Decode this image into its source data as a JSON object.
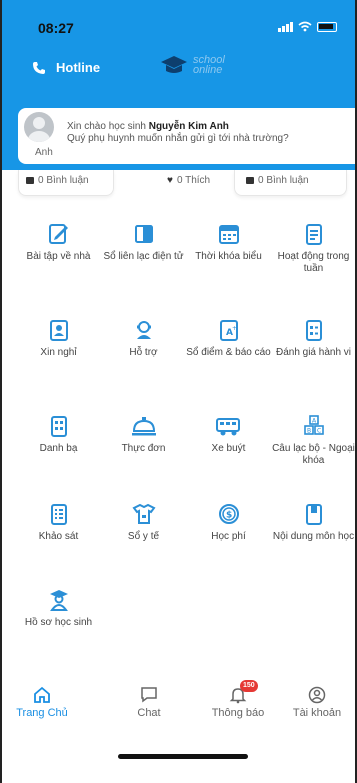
{
  "status_bar": {
    "time": "08:27"
  },
  "header": {
    "hotline_label": "Hotline",
    "logo_text_1": "school",
    "logo_text_2": "online"
  },
  "greeting": {
    "avatar_name": "Anh",
    "line1_prefix": "Xin chào học sinh ",
    "student_name": "Nguyễn Kim Anh",
    "line2": "Quý phụ huynh muốn nhắn gửi gì tới nhà trường?"
  },
  "stats": [
    {
      "icon": "comment-icon",
      "label": "0 Bình luận"
    },
    {
      "icon": "heart-icon",
      "label": "0 Thích"
    },
    {
      "icon": "comment-icon",
      "label": "0 Bình luận"
    }
  ],
  "menu": [
    {
      "id": "homework",
      "icon": "homework-icon",
      "label": "Bài tập về nhà"
    },
    {
      "id": "contact-book",
      "icon": "contact-book-icon",
      "label": "Sổ liên lạc điện tử"
    },
    {
      "id": "timetable",
      "icon": "calendar-icon",
      "label": "Thời khóa biểu"
    },
    {
      "id": "weekly-activities",
      "icon": "clipboard-icon",
      "label": "Hoạt động trong tuần"
    },
    {
      "id": "leave",
      "icon": "leave-icon",
      "label": "Xin nghỉ"
    },
    {
      "id": "support",
      "icon": "support-icon",
      "label": "Hỗ trợ"
    },
    {
      "id": "grades",
      "icon": "grade-book-icon",
      "label": "Sổ điểm & báo cáo"
    },
    {
      "id": "conduct",
      "icon": "evaluation-icon",
      "label": "Đánh giá hành vi"
    },
    {
      "id": "directory",
      "icon": "directory-icon",
      "label": "Danh bạ"
    },
    {
      "id": "menu",
      "icon": "food-menu-icon",
      "label": "Thực đơn"
    },
    {
      "id": "bus",
      "icon": "bus-icon",
      "label": "Xe buýt"
    },
    {
      "id": "clubs",
      "icon": "clubs-icon",
      "label": "Câu lạc bộ - Ngoại khóa"
    },
    {
      "id": "survey",
      "icon": "survey-icon",
      "label": "Khảo sát"
    },
    {
      "id": "health",
      "icon": "health-book-icon",
      "label": "Sổ y tế"
    },
    {
      "id": "fees",
      "icon": "fees-icon",
      "label": "Học phí"
    },
    {
      "id": "curriculum",
      "icon": "book-icon",
      "label": "Nội dung môn học"
    },
    {
      "id": "student-profile",
      "icon": "student-profile-icon",
      "label": "Hồ sơ học sinh"
    }
  ],
  "nav": [
    {
      "id": "home",
      "icon": "home-icon",
      "label": "Trang Chủ",
      "active": true
    },
    {
      "id": "chat",
      "icon": "chat-icon",
      "label": "Chat",
      "active": false
    },
    {
      "id": "notifications",
      "icon": "bell-icon",
      "label": "Thông báo",
      "badge": "150",
      "active": false
    },
    {
      "id": "account",
      "icon": "account-icon",
      "label": "Tài khoản",
      "active": false
    }
  ],
  "colors": {
    "primary": "#1796e6",
    "active_nav": "#1a8fe3",
    "badge": "#e53935",
    "icon_blue": "#2b8fd6"
  }
}
